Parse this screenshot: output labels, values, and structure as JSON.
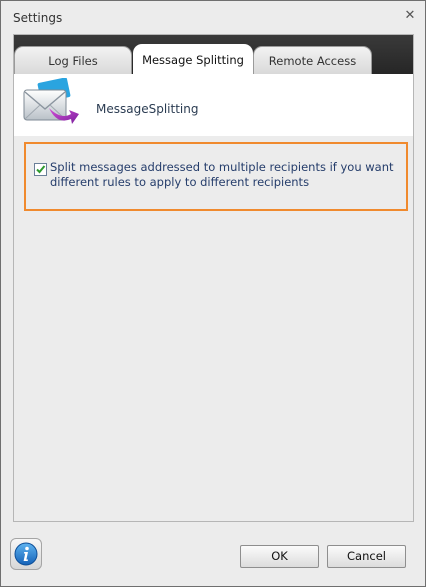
{
  "window": {
    "title": "Settings",
    "close_glyph": "✕"
  },
  "tabs": [
    {
      "label": "Log Files",
      "active": false
    },
    {
      "label": "Message Splitting",
      "active": true
    },
    {
      "label": "Remote Access",
      "active": false
    }
  ],
  "header": {
    "icon": "envelope-arrow-icon",
    "label": "MessageSplitting"
  },
  "option": {
    "checked": true,
    "label": "Split messages addressed to multiple recipients if you want different rules to apply to different recipients"
  },
  "buttons": {
    "ok": "OK",
    "cancel": "Cancel",
    "info_icon": "info-icon"
  },
  "colors": {
    "highlight": "#f08a2e",
    "tab_strip": "#2e2e2e",
    "label_text": "#253d6b"
  }
}
